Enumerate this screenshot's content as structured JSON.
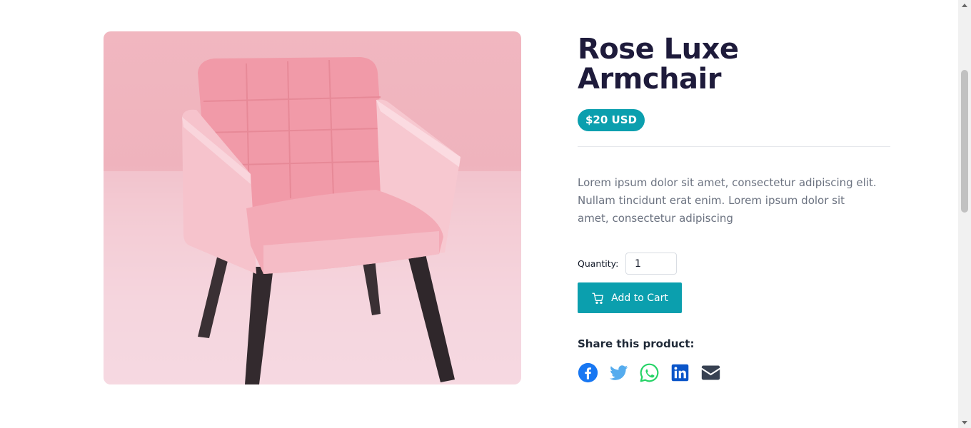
{
  "product": {
    "title": "Rose Luxe Armchair",
    "price": "$20 USD",
    "description": "Lorem ipsum dolor sit amet, consectetur adipiscing elit. Nullam tincidunt erat enim. Lorem ipsum dolor sit amet, consectetur adipiscing",
    "quantity_label": "Quantity:",
    "quantity_value": "1",
    "add_to_cart_label": "Add to Cart",
    "share_label": "Share this product:"
  },
  "share": [
    {
      "name": "facebook-icon",
      "color": "#1877f2"
    },
    {
      "name": "twitter-icon",
      "color": "#55acee"
    },
    {
      "name": "whatsapp-icon",
      "color": "#25d366"
    },
    {
      "name": "linkedin-icon",
      "color": "#0a66c2"
    },
    {
      "name": "email-icon",
      "color": "#374151"
    }
  ],
  "colors": {
    "accent": "#0b9fae",
    "title": "#1e1b3b",
    "body_text": "#6b7280"
  },
  "icons": {
    "cart": "cart-icon"
  }
}
